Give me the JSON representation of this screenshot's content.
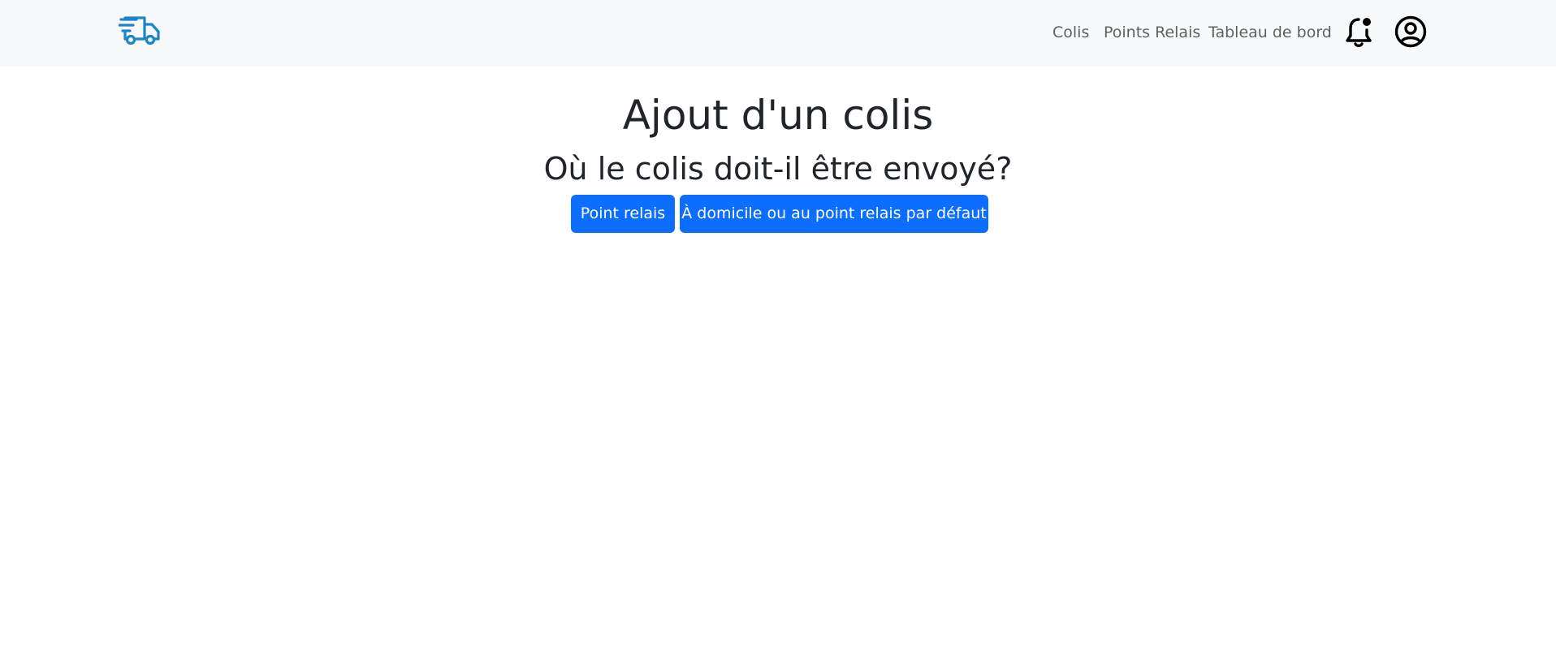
{
  "navbar": {
    "brand_icon": "delivery-truck-icon",
    "brand_color": "#1a86c8",
    "links": [
      {
        "label": "Colis"
      },
      {
        "label": "Points Relais"
      },
      {
        "label": "Tableau de bord"
      }
    ],
    "notification_icon": "bell-notification-icon",
    "account_icon": "user-circle-icon"
  },
  "main": {
    "title": "Ajout d'un colis",
    "question": "Où le colis doit-il être envoyé?",
    "buttons": {
      "relay_point": "Point relais",
      "home_or_default": "À domicile ou au point relais par défaut"
    }
  },
  "colors": {
    "navbar_bg": "#f8f9fa",
    "primary": "#0d6efd",
    "text": "#212529"
  }
}
